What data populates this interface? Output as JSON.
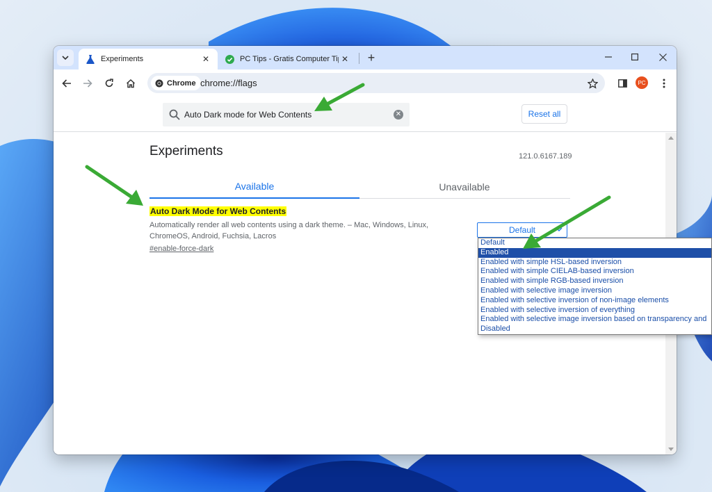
{
  "tabs": [
    {
      "title": "Experiments",
      "active": true
    },
    {
      "title": "PC Tips - Gratis Computer Tips.",
      "active": false
    }
  ],
  "toolbar": {
    "chip_label": "Chrome",
    "url": "chrome://flags",
    "avatar_initials": "PC"
  },
  "flags": {
    "search_value": "Auto Dark mode for Web Contents",
    "reset_label": "Reset all",
    "page_title": "Experiments",
    "version": "121.0.6167.189",
    "tab_available": "Available",
    "tab_unavailable": "Unavailable"
  },
  "experiment": {
    "title": "Auto Dark Mode for Web Contents",
    "description": "Automatically render all web contents using a dark theme. – Mac, Windows, Linux, ChromeOS, Android, Fuchsia, Lacros",
    "link": "#enable-force-dark",
    "selected_value": "Default",
    "options": [
      "Default",
      "Enabled",
      "Enabled with simple HSL-based inversion",
      "Enabled with simple CIELAB-based inversion",
      "Enabled with simple RGB-based inversion",
      "Enabled with selective image inversion",
      "Enabled with selective inversion of non-image elements",
      "Enabled with selective inversion of everything",
      "Enabled with selective image inversion based on transparency and",
      "Disabled"
    ],
    "highlighted_option": "Enabled"
  },
  "colors": {
    "accent": "#1a73e8",
    "highlight": "#ffff00",
    "annotation_arrow": "#3aaa35",
    "titlebar": "#d3e3fd"
  }
}
